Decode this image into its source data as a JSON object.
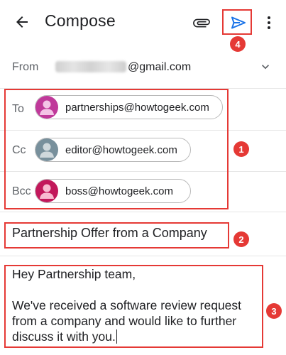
{
  "header": {
    "title": "Compose",
    "back_icon": "arrow-back-icon",
    "attach_icon": "paperclip-icon",
    "send_icon": "send-icon",
    "more_icon": "more-vert-icon"
  },
  "from": {
    "label": "From",
    "domain": "@gmail.com",
    "chevron_icon": "chevron-down-icon"
  },
  "recipients": {
    "to": {
      "label": "To",
      "email": "partnerships@howtogeek.com",
      "avatar_color": "#c0399a"
    },
    "cc": {
      "label": "Cc",
      "email": "editor@howtogeek.com",
      "avatar_color": "#78909c"
    },
    "bcc": {
      "label": "Bcc",
      "email": "boss@howtogeek.com",
      "avatar_color": "#c2185b"
    }
  },
  "subject": "Partnership Offer from a Company",
  "body": {
    "greeting": "Hey Partnership team,",
    "paragraph": "We've received a software review request from a company and would like to further discuss it with you."
  },
  "annotations": {
    "one": "1",
    "two": "2",
    "three": "3",
    "four": "4",
    "color": "#e53935"
  },
  "colors": {
    "accent_blue": "#1a73e8",
    "text": "#202124",
    "muted": "#5f6368"
  }
}
